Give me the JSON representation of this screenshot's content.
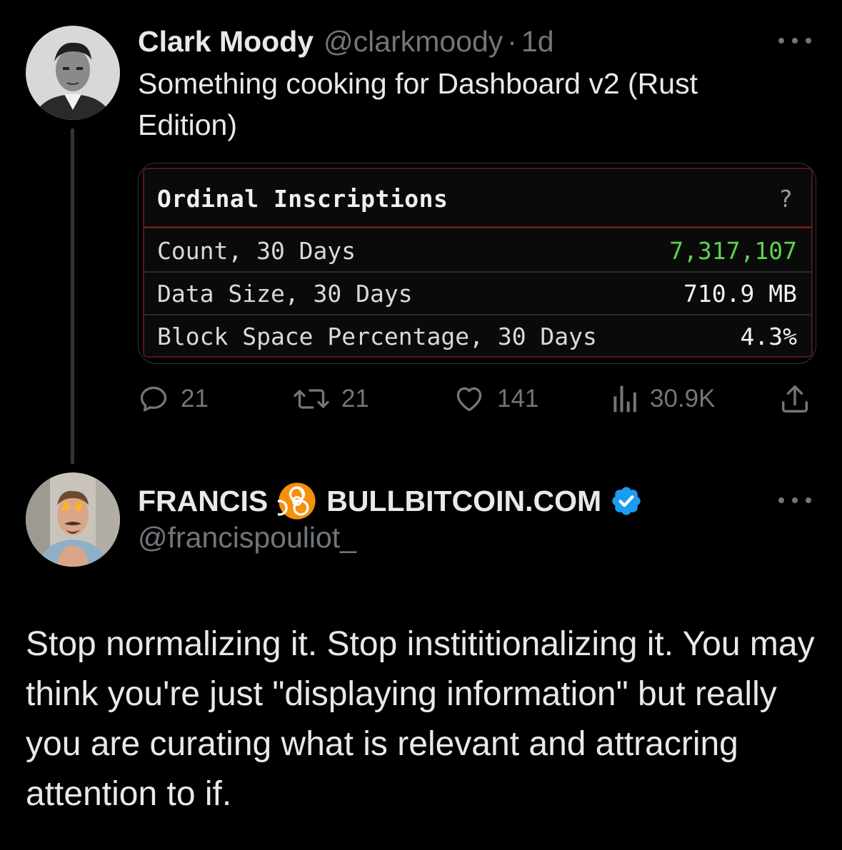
{
  "tweet": {
    "author": {
      "display_name": "Clark Moody",
      "handle": "@clarkmoody",
      "separator": "·",
      "time": "1d"
    },
    "text": "Something cooking for Dashboard v2 (Rust Edition)",
    "media": {
      "title": "Ordinal Inscriptions",
      "help_glyph": "?",
      "rows": [
        {
          "label": "Count, 30 Days",
          "value": "7,317,107",
          "value_color": "#5bd34f"
        },
        {
          "label": "Data Size, 30 Days",
          "value": "710.9 MB",
          "value_color": "#f2f2f2"
        },
        {
          "label": "Block Space Percentage, 30 Days",
          "value": "4.3%",
          "value_color": "#f2f2f2"
        }
      ]
    },
    "actions": {
      "replies": "21",
      "retweets": "21",
      "likes": "141",
      "views": "30.9K"
    }
  },
  "reply": {
    "author": {
      "name_part1": "FRANCIS",
      "name_part2": "BULLBITCOIN.COM",
      "handle": "@francispouliot_",
      "emoji_icon": "biohazard-icon",
      "verified": true
    },
    "text": "Stop normalizing it. Stop instititionalizing it. You may think you're just \"displaying information\" but really you are curating what is relevant and attracring attention to if."
  },
  "colors": {
    "background": "#000000",
    "text_primary": "#e7e9ea",
    "text_secondary": "#71767b",
    "verified_blue": "#1d9bf0",
    "biohazard_orange": "#f4900c",
    "terminal_border": "#5a1414",
    "terminal_green": "#5bd34f"
  }
}
